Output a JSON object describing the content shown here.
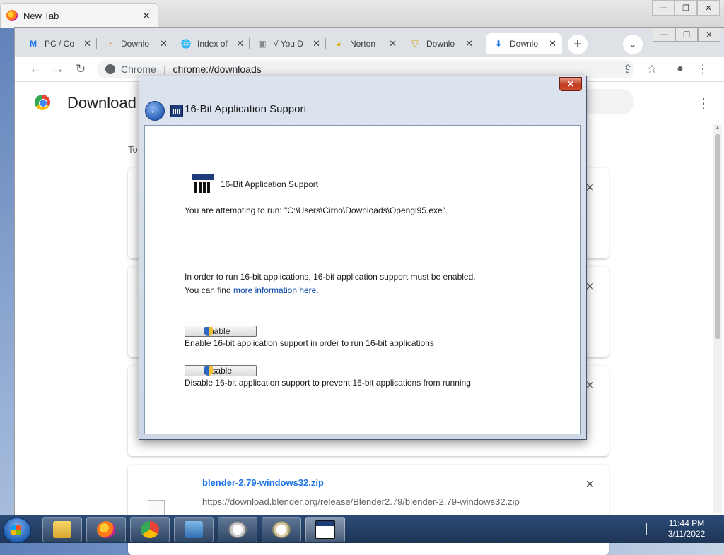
{
  "bg_window": {
    "tab_title": "New Tab",
    "tab_close": "✕",
    "controls": [
      "—",
      "❐",
      "✕"
    ]
  },
  "chrome": {
    "tabs": [
      {
        "title": "PC / Co",
        "icon": "M",
        "close": "✕"
      },
      {
        "title": "Downlo",
        "icon": "◔",
        "close": "✕"
      },
      {
        "title": "Index of",
        "icon": "🌐",
        "close": "✕"
      },
      {
        "title": "√ You D",
        "icon": "▣",
        "close": "✕"
      },
      {
        "title": "Norton",
        "icon": "◕",
        "close": "✕"
      },
      {
        "title": "Downlo",
        "icon": "⛉",
        "close": "✕"
      },
      {
        "title": "Downlo",
        "icon": "⬇",
        "close": "✕"
      }
    ],
    "new_tab": "+",
    "tab_search": "⌄",
    "controls": [
      "—",
      "❐",
      "✕"
    ],
    "toolbar": {
      "back": "←",
      "forward": "→",
      "reload": "↻",
      "site_label": "Chrome",
      "separator": "|",
      "url": "chrome://downloads",
      "share": "⇪",
      "star": "☆",
      "profile": "●",
      "menu": "⋮"
    },
    "page": {
      "title": "Download",
      "menu": "⋮",
      "today_label": "To",
      "card_close": "✕",
      "last_card": {
        "name": "blender-2.79-windows32.zip",
        "url": "https://download.blender.org/release/Blender2.79/blender-2.79-windows32.zip"
      }
    }
  },
  "dialog": {
    "close": "✕",
    "back": "←",
    "header_title": "16-Bit Application Support",
    "app_title": "16-Bit Application Support",
    "attempt_text": "You are attempting to run: \"C:\\Users\\Cirno\\Downloads\\Opengl95.exe\".",
    "info_line1": "In order to run 16-bit applications, 16-bit application support must be enabled.",
    "info_line2_prefix": "You can find ",
    "info_link": "more information here.",
    "enable_label": "Enable",
    "enable_desc": "Enable 16-bit application support in order to run 16-bit applications",
    "disable_label": "Disable",
    "disable_desc": "Disable 16-bit application support to prevent 16-bit applications from running"
  },
  "taskbar": {
    "clock_time": "11:44 PM",
    "clock_date": "3/11/2022"
  }
}
